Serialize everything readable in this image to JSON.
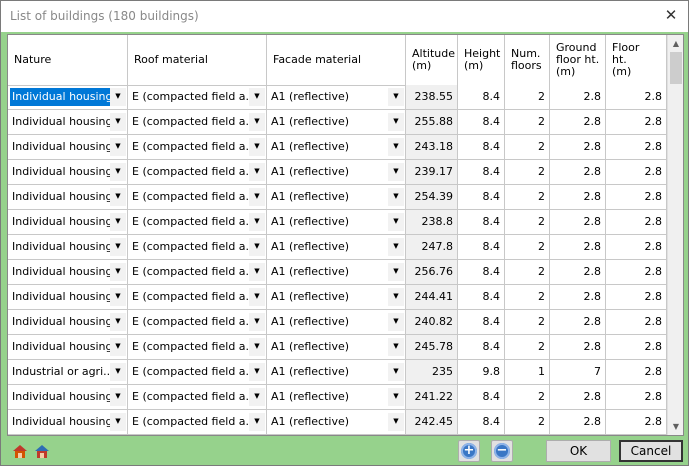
{
  "window": {
    "title": "List of buildings (180 buildings)"
  },
  "columns": [
    {
      "label": "Nature"
    },
    {
      "label": "Roof material"
    },
    {
      "label": "Facade material"
    },
    {
      "label": "Altitude\n(m)"
    },
    {
      "label": "Height\n(m)"
    },
    {
      "label": "Num.\nfloors"
    },
    {
      "label": "Ground\nfloor ht.\n(m)"
    },
    {
      "label": "Floor\nht.\n(m)"
    }
  ],
  "rows": [
    {
      "nature": "Individual housing",
      "roof": "E (compacted field a...",
      "facade": "A1 (reflective)",
      "altitude": "238.55",
      "height": "8.4",
      "floors": "2",
      "ground_ht": "2.8",
      "floor_ht": "2.8"
    },
    {
      "nature": "Individual housing",
      "roof": "E (compacted field a...",
      "facade": "A1 (reflective)",
      "altitude": "255.88",
      "height": "8.4",
      "floors": "2",
      "ground_ht": "2.8",
      "floor_ht": "2.8"
    },
    {
      "nature": "Individual housing",
      "roof": "E (compacted field a...",
      "facade": "A1 (reflective)",
      "altitude": "243.18",
      "height": "8.4",
      "floors": "2",
      "ground_ht": "2.8",
      "floor_ht": "2.8"
    },
    {
      "nature": "Individual housing",
      "roof": "E (compacted field a...",
      "facade": "A1 (reflective)",
      "altitude": "239.17",
      "height": "8.4",
      "floors": "2",
      "ground_ht": "2.8",
      "floor_ht": "2.8"
    },
    {
      "nature": "Individual housing",
      "roof": "E (compacted field a...",
      "facade": "A1 (reflective)",
      "altitude": "254.39",
      "height": "8.4",
      "floors": "2",
      "ground_ht": "2.8",
      "floor_ht": "2.8"
    },
    {
      "nature": "Individual housing",
      "roof": "E (compacted field a...",
      "facade": "A1 (reflective)",
      "altitude": "238.8",
      "height": "8.4",
      "floors": "2",
      "ground_ht": "2.8",
      "floor_ht": "2.8"
    },
    {
      "nature": "Individual housing",
      "roof": "E (compacted field a...",
      "facade": "A1 (reflective)",
      "altitude": "247.8",
      "height": "8.4",
      "floors": "2",
      "ground_ht": "2.8",
      "floor_ht": "2.8"
    },
    {
      "nature": "Individual housing",
      "roof": "E (compacted field a...",
      "facade": "A1 (reflective)",
      "altitude": "256.76",
      "height": "8.4",
      "floors": "2",
      "ground_ht": "2.8",
      "floor_ht": "2.8"
    },
    {
      "nature": "Individual housing",
      "roof": "E (compacted field a...",
      "facade": "A1 (reflective)",
      "altitude": "244.41",
      "height": "8.4",
      "floors": "2",
      "ground_ht": "2.8",
      "floor_ht": "2.8"
    },
    {
      "nature": "Individual housing",
      "roof": "E (compacted field a...",
      "facade": "A1 (reflective)",
      "altitude": "240.82",
      "height": "8.4",
      "floors": "2",
      "ground_ht": "2.8",
      "floor_ht": "2.8"
    },
    {
      "nature": "Individual housing",
      "roof": "E (compacted field a...",
      "facade": "A1 (reflective)",
      "altitude": "245.78",
      "height": "8.4",
      "floors": "2",
      "ground_ht": "2.8",
      "floor_ht": "2.8"
    },
    {
      "nature": "Industrial or agri...",
      "roof": "E (compacted field a...",
      "facade": "A1 (reflective)",
      "altitude": "235",
      "height": "9.8",
      "floors": "1",
      "ground_ht": "7",
      "floor_ht": "2.8"
    },
    {
      "nature": "Individual housing",
      "roof": "E (compacted field a...",
      "facade": "A1 (reflective)",
      "altitude": "241.22",
      "height": "8.4",
      "floors": "2",
      "ground_ht": "2.8",
      "floor_ht": "2.8"
    },
    {
      "nature": "Individual housing",
      "roof": "E (compacted field a...",
      "facade": "A1 (reflective)",
      "altitude": "242.45",
      "height": "8.4",
      "floors": "2",
      "ground_ht": "2.8",
      "floor_ht": "2.8"
    }
  ],
  "buttons": {
    "ok": "OK",
    "cancel": "Cancel"
  },
  "icons": {
    "building_add": "house-add-icon",
    "building_view": "house-view-icon",
    "add": "add-row-icon",
    "remove": "remove-row-icon"
  },
  "colors": {
    "selection": "#0078d7",
    "background": "#96d28c"
  }
}
